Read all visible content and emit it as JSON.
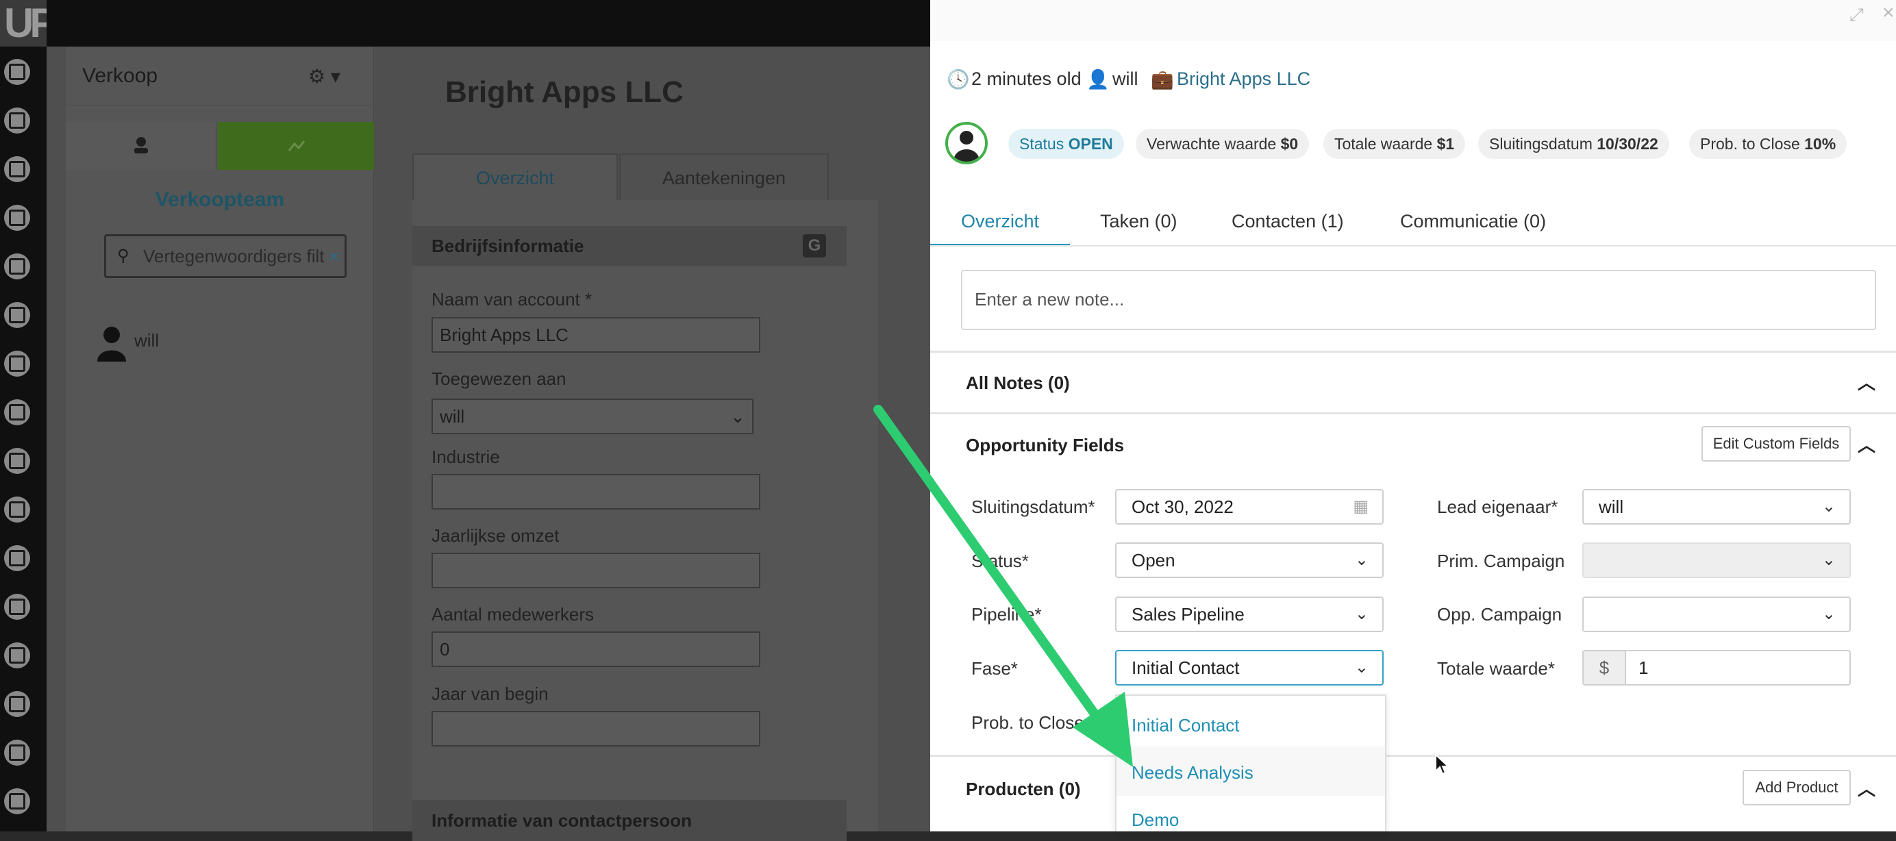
{
  "app": {
    "logo": "UP"
  },
  "sidebar": {
    "title": "Verkoop",
    "team_title": "Verkoopteam",
    "filter_placeholder": "Vertegenwoordigers filt",
    "reps": [
      "will"
    ]
  },
  "middle": {
    "heading_fragment": "Bright Apps LLC",
    "tabs": [
      "Overzicht",
      "Aantekeningen"
    ],
    "section_company": "Bedrijfsinformatie",
    "fields": [
      {
        "label": "Naam van account *",
        "value": "Bright Apps LLC"
      },
      {
        "label": "Toegewezen aan",
        "value": "will"
      },
      {
        "label": "Industrie",
        "value": ""
      },
      {
        "label": "Jaarlijkse omzet",
        "value": ""
      },
      {
        "label": "Aantal medewerkers",
        "value": "0"
      },
      {
        "label": "Jaar van begin",
        "value": ""
      }
    ],
    "section_contact": "Informatie van contactpersoon"
  },
  "modal": {
    "meta": {
      "age": "2 minutes old",
      "owner": "will",
      "company": "Bright Apps LLC"
    },
    "pills": [
      {
        "label": "Status",
        "value": "OPEN"
      },
      {
        "label": "Verwachte waarde",
        "value": "$0"
      },
      {
        "label": "Totale waarde",
        "value": "$1"
      },
      {
        "label": "Sluitingsdatum",
        "value": "10/30/22"
      },
      {
        "label": "Prob. to Close",
        "value": "10%"
      }
    ],
    "tabs": [
      "Overzicht",
      "Taken (0)",
      "Contacten (1)",
      "Communicatie (0)"
    ],
    "note_placeholder": "Enter a new note...",
    "all_notes": "All Notes (0)",
    "opportunity_fields": "Opportunity Fields",
    "edit_custom_fields": "Edit Custom Fields",
    "fields": {
      "close_date_label": "Sluitingsdatum*",
      "close_date_value": "Oct 30, 2022",
      "status_label": "Status*",
      "status_value": "Open",
      "pipeline_label": "Pipeline*",
      "pipeline_value": "Sales Pipeline",
      "phase_label": "Fase*",
      "phase_value": "Initial Contact",
      "prob_label": "Prob. to Close",
      "lead_owner_label": "Lead eigenaar*",
      "lead_owner_value": "will",
      "prim_campaign_label": "Prim. Campaign",
      "prim_campaign_value": "",
      "opp_campaign_label": "Opp. Campaign",
      "opp_campaign_value": "",
      "total_label": "Totale waarde*",
      "total_currency": "$",
      "total_value": "1"
    },
    "phase_options": [
      "Initial Contact",
      "Needs Analysis",
      "Demo"
    ],
    "products": "Producten (0)",
    "add_product": "Add Product"
  },
  "colors": {
    "accent": "#2a98c0",
    "highlight_arrow": "#2ecc71",
    "avatar_ring": "#44b04a"
  }
}
